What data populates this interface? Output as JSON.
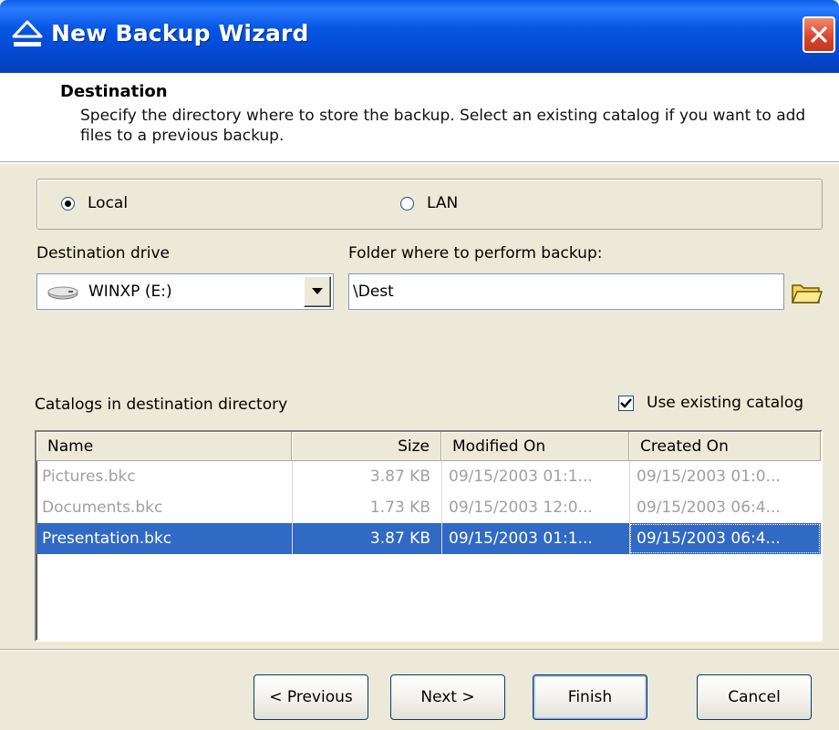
{
  "window": {
    "title": "New Backup Wizard"
  },
  "header": {
    "title": "Destination",
    "description": "Specify the directory where to store the backup. Select an existing catalog if you want to add files to a previous backup."
  },
  "location": {
    "options": [
      {
        "label": "Local",
        "selected": true
      },
      {
        "label": "LAN",
        "selected": false
      }
    ]
  },
  "drive": {
    "label": "Destination drive",
    "value": "WINXP (E:)"
  },
  "folder": {
    "label": "Folder where to perform backup:",
    "value": "\\Dest"
  },
  "catalogs": {
    "label": "Catalogs in destination directory",
    "use_existing_label": "Use existing catalog",
    "use_existing_checked": true,
    "columns": [
      "Name",
      "Size",
      "Modified On",
      "Created On"
    ],
    "rows": [
      {
        "name": "Pictures.bkc",
        "size": "3.87 KB",
        "modified": "09/15/2003 01:1...",
        "created": "09/15/2003 01:0...",
        "selected": false
      },
      {
        "name": "Documents.bkc",
        "size": "1.73 KB",
        "modified": "09/15/2003 12:0...",
        "created": "09/15/2003 06:4...",
        "selected": false
      },
      {
        "name": "Presentation.bkc",
        "size": "3.87 KB",
        "modified": "09/15/2003 01:1...",
        "created": "09/15/2003 06:4...",
        "selected": true
      }
    ]
  },
  "buttons": {
    "previous": "< Previous",
    "next": "Next >",
    "finish": "Finish",
    "cancel": "Cancel"
  },
  "icons": {
    "app": "eject-icon",
    "close": "close-icon",
    "drive": "drive-icon",
    "folder": "folder-icon",
    "dropdown": "chevron-down-icon"
  },
  "colors": {
    "titlebar": "#0655e4",
    "selection": "#316ac5",
    "close": "#d8432a"
  }
}
